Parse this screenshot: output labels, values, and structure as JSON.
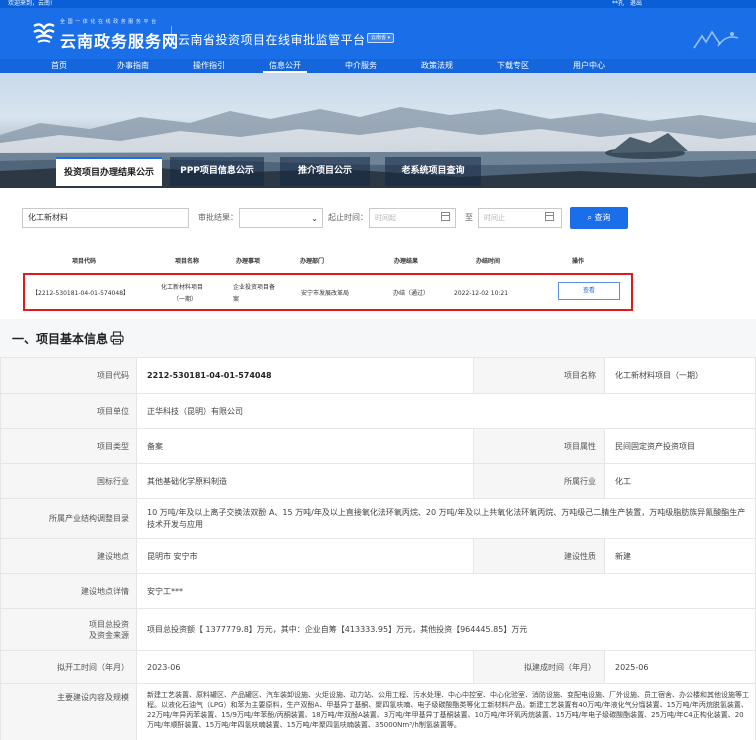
{
  "topbar": {
    "welcome": "欢迎来到，云南!",
    "user": "**孔",
    "logout": "退出"
  },
  "header": {
    "brand_sub": "全 国 一 体 化 在 线 政 务 服 务 平 台",
    "brand_main": "云南政务服务网",
    "portal_title": "云南省投资项目在线审批监管平台",
    "region": "云南省 ▾"
  },
  "nav": {
    "items": [
      "首页",
      "办事指南",
      "操作指引",
      "信息公开",
      "中介服务",
      "政策法规",
      "下载专区",
      "用户中心"
    ],
    "active": "信息公开"
  },
  "tabs": [
    "投资项目办理结果公示",
    "PPP项目信息公示",
    "推介项目公示",
    "老系统项目查询"
  ],
  "search": {
    "keyword": "化工新材料",
    "result_label": "审批结果：",
    "time_label": "起止时间：",
    "start_placeholder": "时间起",
    "to_label": "至",
    "end_placeholder": "时间止",
    "query_button": "查询"
  },
  "result_table": {
    "headers": [
      "项目代码",
      "项目名称",
      "办理事项",
      "办理部门",
      "办理结果",
      "办结时间",
      "操作"
    ],
    "row": {
      "code": "【2212-530181-04-01-574048】",
      "name_line1": "化工新材料项目",
      "name_line2": "（一期）",
      "matter_line1": "企业投资项目备",
      "matter_line2": "案",
      "dept": "安宁市发展改革局",
      "result": "办结（通过）",
      "time": "2022-12-02 10:21",
      "action": "查看"
    }
  },
  "detail": {
    "section_title": "一、项目基本信息",
    "rows": {
      "project_code_label": "项目代码",
      "project_code": "2212-530181-04-01-574048",
      "project_name_label": "项目名称",
      "project_name": "化工新材料项目（一期）",
      "unit_label": "项目单位",
      "unit": "正华科技（昆明）有限公司",
      "type_label": "项目类型",
      "type": "备案",
      "attr_label": "项目属性",
      "attr": "民间固定资产投资项目",
      "industry_label": "国标行业",
      "industry": "其他基础化学原料制造",
      "sector_label": "所属行业",
      "sector": "化工",
      "catalog_label": "所属产业结构调整目录",
      "catalog": "10 万吨/年及以上离子交换法双酚 A、15 万吨/年及以上直接氧化法环氧丙烷、20 万吨/年及以上共氧化法环氧丙烷、万吨级己二腈生产装置，万吨级脂肪族异氰酸酯生产技术开发与应用",
      "location_label": "建设地点",
      "location": "昆明市 安宁市",
      "nature_label": "建设性质",
      "nature": "新建",
      "location_detail_label": "建设地点详情",
      "location_detail": "安宁工***",
      "investment_label_1": "项目总投资",
      "investment_label_2": "及资金来源",
      "investment": "项目总投资额【 1377779.8】万元，其中：企业自筹【413333.95】万元，其他投资【964445.85】万元",
      "start_label": "拟开工时间（年月）",
      "start": "2023-06",
      "finish_label": "拟建成时间（年月）",
      "finish": "2025-06",
      "scope_label": "主要建设内容及规模",
      "scope": "新建工艺装置、原料罐区、产品罐区、汽车装卸设施、火炬设施、动力站、公用工程、污水处理、中心中控室、中心化验室、消防设施、变配电设施、厂外设施、员工宿舍、办公楼和其他设施等工程。以液化石油气（LPG）和苯为主要原料，生产双酚A、甲基异丁基酮、聚四氢呋喃、电子级碳酸酯类等化工新材料产品。新建工艺装置有40万吨/年液化气分馏装置、15万吨/年丙烷脱氢装置、22万吨/年异丙苯装置、15/9万吨/年苯酚/丙酮装置、18万吨/年双酚A装置、3万吨/年甲基异丁基酮装置、10万吨/年环氧丙烷装置、15万吨/年电子级碳酸酯装置、25万吨/年C4正构化装置、20万吨/年顺酐装置、15万吨/年四氢呋喃装置、15万吨/年聚四氢呋喃装置、35000Nm³/h制氢装置等。"
    }
  }
}
